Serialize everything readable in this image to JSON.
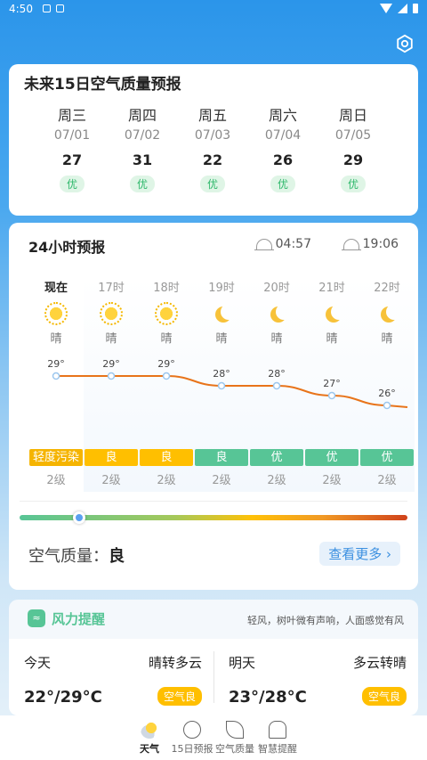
{
  "status": {
    "time": "4:50"
  },
  "aq15": {
    "title": "未来15日空气质量预报",
    "days": [
      {
        "name": "周三",
        "date": "07/01",
        "value": "27",
        "level": "优"
      },
      {
        "name": "周四",
        "date": "07/02",
        "value": "31",
        "level": "优"
      },
      {
        "name": "周五",
        "date": "07/03",
        "value": "22",
        "level": "优"
      },
      {
        "name": "周六",
        "date": "07/04",
        "value": "26",
        "level": "优"
      },
      {
        "name": "周日",
        "date": "07/05",
        "value": "29",
        "level": "优"
      }
    ]
  },
  "forecast24": {
    "title": "24小时预报",
    "sunrise": "04:57",
    "sunset": "19:06",
    "hours": [
      {
        "label": "现在",
        "weather": "晴",
        "icon": "sun-icon",
        "temp": "29°",
        "temp_value": 29,
        "aqi": "轻度污染",
        "aqi_color": "#f5b400",
        "level": "2级"
      },
      {
        "label": "17时",
        "weather": "晴",
        "icon": "sun-icon",
        "temp": "29°",
        "temp_value": 29,
        "aqi": "良",
        "aqi_color": "#ffbf00",
        "level": "2级"
      },
      {
        "label": "18时",
        "weather": "晴",
        "icon": "sun-icon",
        "temp": "29°",
        "temp_value": 29,
        "aqi": "良",
        "aqi_color": "#ffbf00",
        "level": "2级"
      },
      {
        "label": "19时",
        "weather": "晴",
        "icon": "moon-icon",
        "temp": "28°",
        "temp_value": 28,
        "aqi": "良",
        "aqi_color": "#57c596",
        "level": "2级"
      },
      {
        "label": "20时",
        "weather": "晴",
        "icon": "moon-icon",
        "temp": "28°",
        "temp_value": 28,
        "aqi": "优",
        "aqi_color": "#57c596",
        "level": "2级"
      },
      {
        "label": "21时",
        "weather": "晴",
        "icon": "moon-icon",
        "temp": "27°",
        "temp_value": 27,
        "aqi": "优",
        "aqi_color": "#57c596",
        "level": "2级"
      },
      {
        "label": "22时",
        "weather": "晴",
        "icon": "moon-icon",
        "temp": "26°",
        "temp_value": 26,
        "aqi": "优",
        "aqi_color": "#57c596",
        "level": "2级"
      }
    ],
    "air_quality_label": "空气质量：",
    "air_quality_value": "良",
    "more_label": "查看更多"
  },
  "wind": {
    "title": "风力提醒",
    "description": "轻风，树叶微有声响，人面感觉有风",
    "today": {
      "name": "今天",
      "condition": "晴转多云",
      "range": "22°/29°C",
      "badge": "空气良"
    },
    "tomorrow": {
      "name": "明天",
      "condition": "多云转晴",
      "range": "23°/28°C",
      "badge": "空气良"
    }
  },
  "nav": [
    {
      "label": "天气",
      "icon": "weather-icon",
      "active": true
    },
    {
      "label": "15日预报",
      "icon": "globe-icon"
    },
    {
      "label": "空气质量",
      "icon": "leaf-icon"
    },
    {
      "label": "智慧提醒",
      "icon": "bell-icon"
    }
  ]
}
